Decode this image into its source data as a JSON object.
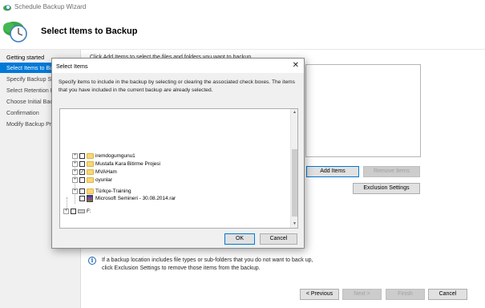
{
  "window": {
    "title": "Schedule Backup Wizard"
  },
  "header": {
    "title": "Select Items to Backup"
  },
  "sidebar": {
    "items": [
      {
        "label": "Getting started"
      },
      {
        "label": "Select Items to Backup"
      },
      {
        "label": "Specify Backup Schedule"
      },
      {
        "label": "Select Retention Policy"
      },
      {
        "label": "Choose Initial Backup"
      },
      {
        "label": "Confirmation"
      },
      {
        "label": "Modify Backup Progress"
      }
    ]
  },
  "content": {
    "hint": "Click Add Items to select the files and folders you want to backup.",
    "add_items_label": "Add Items",
    "remove_items_label": "Remove Items",
    "exclusion_settings_label": "Exclusion Settings",
    "info_text": "If a backup location includes file types or sub-folders that you do not want to back up, click Exclusion Settings to remove those items from the backup.",
    "info_icon": "i"
  },
  "footer": {
    "previous_label": "< Previous",
    "next_label": "Next >",
    "finish_label": "Finish",
    "cancel_label": "Cancel"
  },
  "dialog": {
    "title": "Select Items",
    "close_glyph": "✕",
    "description": "Specify items to include in the backup by selecting or clearing the associated check boxes. The items that you have included in the current backup are already selected.",
    "ok_label": "OK",
    "cancel_label": "Cancel",
    "tree": [
      {
        "label": "iremdogumgunu1",
        "type": "folder",
        "checked": false
      },
      {
        "label": "Mustafa Kara Bitirme Projesi",
        "type": "folder",
        "checked": false
      },
      {
        "label": "MVAHam",
        "type": "folder",
        "checked": true
      },
      {
        "label": "oyunlar",
        "type": "folder",
        "checked": false
      },
      {
        "label": "Türkçe-Training",
        "type": "folder",
        "checked": false
      },
      {
        "label": "Microsoft Semineri - 30.08.2014.rar",
        "type": "rar",
        "checked": false
      },
      {
        "label": "F:",
        "type": "drive",
        "checked": false
      }
    ],
    "expander_glyph": "+",
    "check_glyph": "✓"
  },
  "icons": {
    "scroll_up": "▲",
    "scroll_down": "▼"
  },
  "colors": {
    "accent": "#0078d7",
    "folder": "#f8d775"
  }
}
